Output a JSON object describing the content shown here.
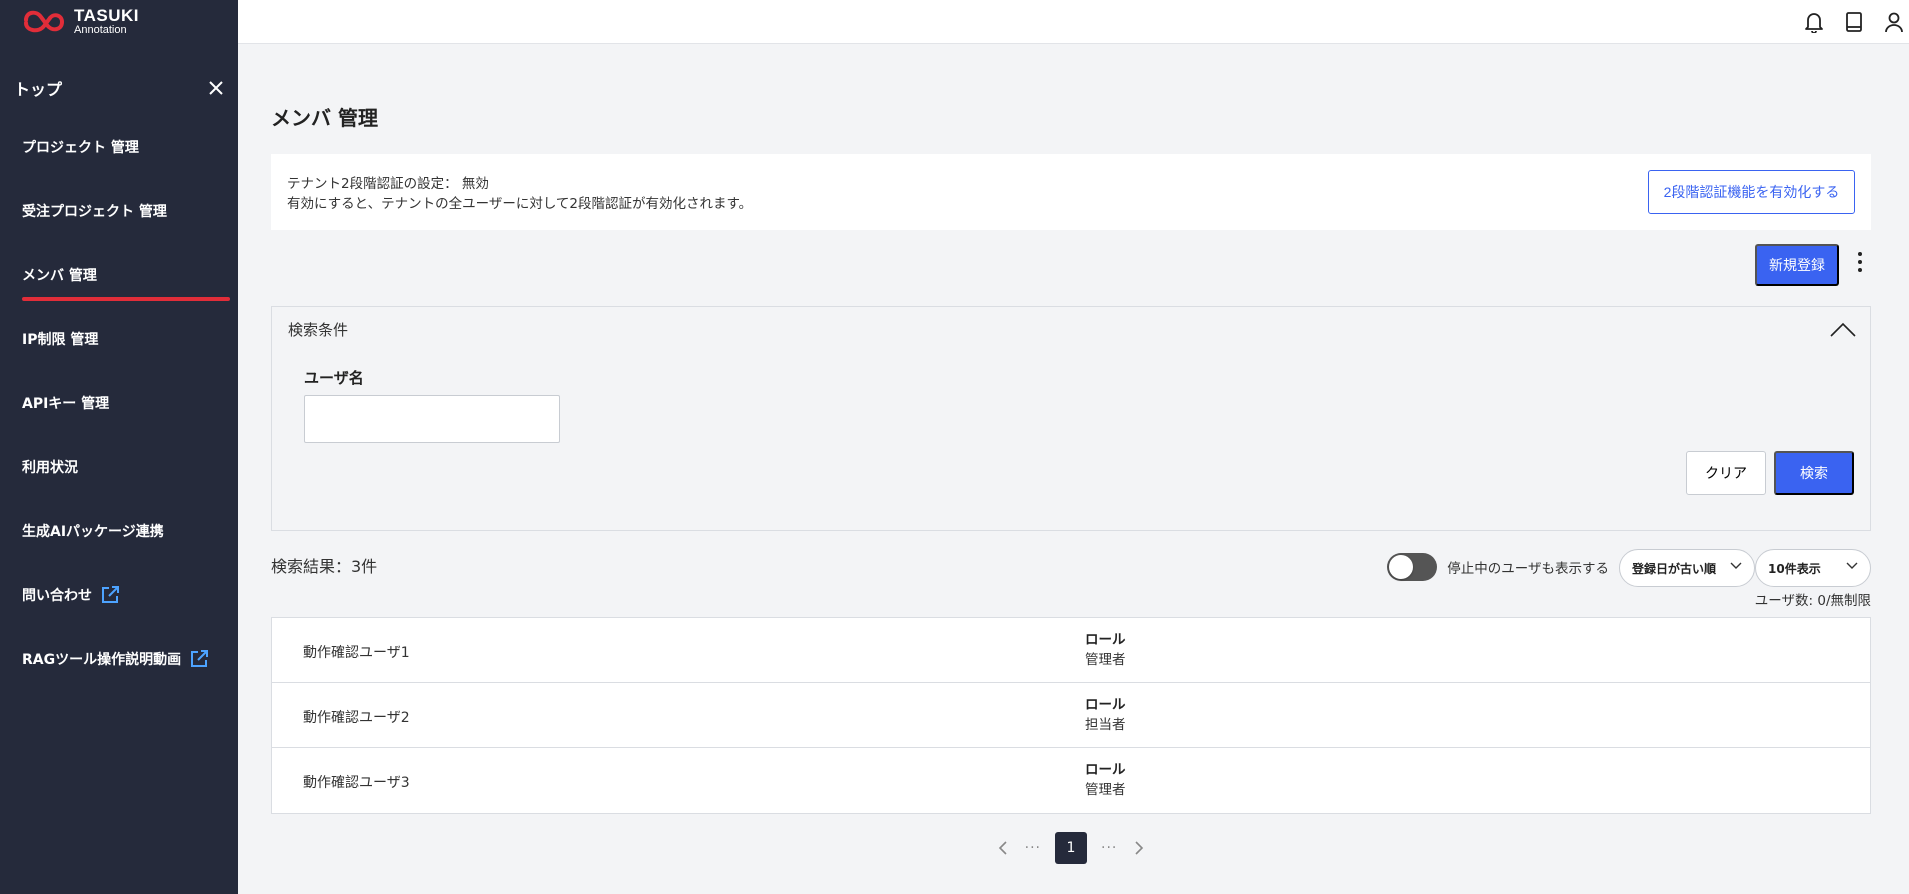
{
  "brand": {
    "name": "TASUKI",
    "subtitle": "Annotation",
    "primary_color": "#3a63f1",
    "sidebar_color": "#252a3b",
    "accent_red": "#e12d39"
  },
  "sidebar": {
    "title": "トップ",
    "items": [
      {
        "label": "プロジェクト 管理"
      },
      {
        "label": "受注プロジェクト 管理"
      },
      {
        "label": "メンバ 管理"
      },
      {
        "label": "IP制限 管理"
      },
      {
        "label": "APIキー 管理"
      },
      {
        "label": "利用状況"
      },
      {
        "label": "生成AIパッケージ連携"
      },
      {
        "label": "問い合わせ"
      },
      {
        "label": "RAGツール操作説明動画"
      }
    ]
  },
  "main": {
    "title": "メンバ 管理",
    "twofa": {
      "status_line": "テナント2段階認証の設定：  無効",
      "description": "有効にすると、テナントの全ユーザーに対して2段階認証が有効化されます。",
      "button_label": "2段階認証機能を有効化する"
    },
    "new_button_label": "新規登録",
    "search": {
      "header": "検索条件",
      "username_label": "ユーザ名",
      "username_value": "",
      "clear_label": "クリア",
      "search_label": "検索"
    },
    "results": {
      "count_text": "検索結果：3件",
      "toggle_label": "停止中のユーザも表示する",
      "sort_value": "登録日が古い順",
      "per_page_value": "10件表示",
      "user_total": "ユーザ数: 0/無制限"
    },
    "users": [
      {
        "name": "動作確認ユーザ1",
        "role_label": "ロール",
        "role": "管理者"
      },
      {
        "name": "動作確認ユーザ2",
        "role_label": "ロール",
        "role": "担当者"
      },
      {
        "name": "動作確認ユーザ3",
        "role_label": "ロール",
        "role": "管理者"
      }
    ],
    "pagination": {
      "current_page": "1",
      "ellipsis": "···"
    }
  }
}
